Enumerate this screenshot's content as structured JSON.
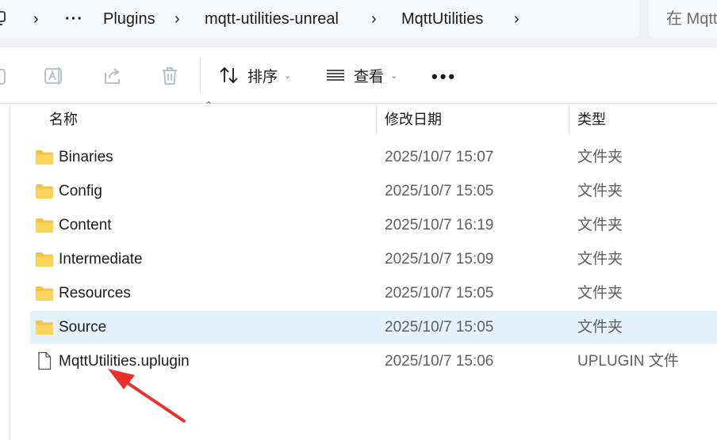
{
  "breadcrumb": {
    "more": "···",
    "items": [
      "Plugins",
      "mqtt-utilities-unreal",
      "MqttUtilities"
    ]
  },
  "search": {
    "placeholder": "在 Mqtt"
  },
  "toolbar": {
    "sort_label": "排序",
    "view_label": "查看",
    "more_label": "•••",
    "icons": [
      "cut-icon",
      "rename-icon",
      "share-icon",
      "delete-icon",
      "sort-icon",
      "view-icon"
    ]
  },
  "columns": {
    "name": "名称",
    "date": "修改日期",
    "type": "类型"
  },
  "files": [
    {
      "name": "Binaries",
      "date": "2025/10/7 15:07",
      "type": "文件夹",
      "kind": "folder"
    },
    {
      "name": "Config",
      "date": "2025/10/7 15:05",
      "type": "文件夹",
      "kind": "folder"
    },
    {
      "name": "Content",
      "date": "2025/10/7 16:19",
      "type": "文件夹",
      "kind": "folder"
    },
    {
      "name": "Intermediate",
      "date": "2025/10/7 15:09",
      "type": "文件夹",
      "kind": "folder"
    },
    {
      "name": "Resources",
      "date": "2025/10/7 15:05",
      "type": "文件夹",
      "kind": "folder"
    },
    {
      "name": "Source",
      "date": "2025/10/7 15:05",
      "type": "文件夹",
      "kind": "folder",
      "selected": true
    },
    {
      "name": "MqttUtilities.uplugin",
      "date": "2025/10/7 15:06",
      "type": "UPLUGIN 文件",
      "kind": "file"
    }
  ],
  "colors": {
    "selection": "#e5f1fb",
    "folder": "#f4c542",
    "arrow": "#e8322b"
  }
}
